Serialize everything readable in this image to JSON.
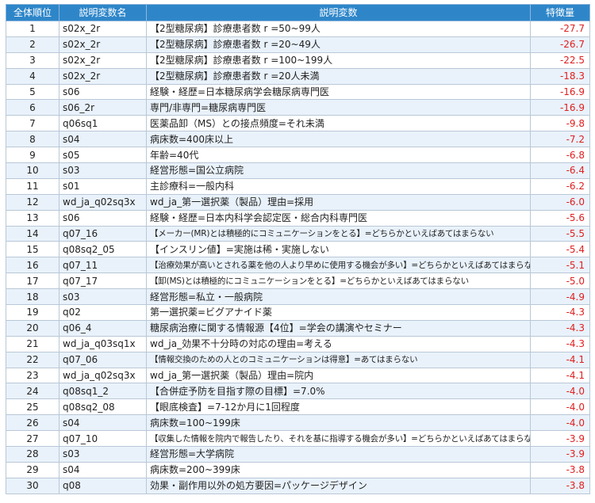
{
  "headers": [
    "全体順位",
    "説明変数名",
    "説明変数",
    "特徴量"
  ],
  "rows": [
    {
      "rank": "1",
      "code": "s02x_2r",
      "desc": "【2型糖尿病】診療患者数 r =50~99人",
      "value": "-27.7"
    },
    {
      "rank": "2",
      "code": "s02x_2r",
      "desc": "【2型糖尿病】診療患者数 r =20~49人",
      "value": "-26.7"
    },
    {
      "rank": "3",
      "code": "s02x_2r",
      "desc": "【2型糖尿病】診療患者数 r =100~199人",
      "value": "-22.5"
    },
    {
      "rank": "4",
      "code": "s02x_2r",
      "desc": "【2型糖尿病】診療患者数 r =20人未満",
      "value": "-18.3"
    },
    {
      "rank": "5",
      "code": "s06",
      "desc": "経験・経歴=日本糖尿病学会糖尿病専門医",
      "value": "-16.9"
    },
    {
      "rank": "6",
      "code": "s06_2r",
      "desc": "専門/非専門=糖尿病専門医",
      "value": "-16.9"
    },
    {
      "rank": "7",
      "code": "q06sq1",
      "desc": "医薬品卸（MS）との接点頻度=それ未満",
      "value": "-9.8"
    },
    {
      "rank": "8",
      "code": "s04",
      "desc": "病床数=400床以上",
      "value": "-7.2"
    },
    {
      "rank": "9",
      "code": "s05",
      "desc": "年齢=40代",
      "value": "-6.8"
    },
    {
      "rank": "10",
      "code": "s03",
      "desc": "経営形態=国公立病院",
      "value": "-6.4"
    },
    {
      "rank": "11",
      "code": "s01",
      "desc": "主診療科=一般内科",
      "value": "-6.2"
    },
    {
      "rank": "12",
      "code": "wd_ja_q02sq3x",
      "desc": "wd_ja_第一選択薬（製品）理由=採用",
      "value": "-6.0"
    },
    {
      "rank": "13",
      "code": "s06",
      "desc": "経験・経歴=日本内科学会認定医・総合内科専門医",
      "value": "-5.6"
    },
    {
      "rank": "14",
      "code": "q07_16",
      "desc": "【メーカー(MR)とは積極的にコミュニケーションをとる】=どちらかといえばあてはまらない",
      "value": "-5.5",
      "small": true
    },
    {
      "rank": "15",
      "code": "q08sq2_05",
      "desc": "【インスリン値】=実施は稀・実施しない",
      "value": "-5.4"
    },
    {
      "rank": "16",
      "code": "q07_11",
      "desc": "【治療効果が高いとされる薬を他の人より早めに使用する機会が多い】=どちらかといえばあてはまらない",
      "value": "-5.1",
      "small": true
    },
    {
      "rank": "17",
      "code": "q07_17",
      "desc": "【卸(MS)とは積極的にコミュニケーションをとる】=どちらかといえばあてはまらない",
      "value": "-5.0",
      "small": true
    },
    {
      "rank": "18",
      "code": "s03",
      "desc": "経営形態=私立・一般病院",
      "value": "-4.9"
    },
    {
      "rank": "19",
      "code": "q02",
      "desc": "第一選択薬=ビグアナイド薬",
      "value": "-4.3"
    },
    {
      "rank": "20",
      "code": "q06_4",
      "desc": "糖尿病治療に関する情報源【4位】=学会の講演やセミナー",
      "value": "-4.3"
    },
    {
      "rank": "21",
      "code": "wd_ja_q03sq1x",
      "desc": "wd_ja_効果不十分時の対応の理由=考える",
      "value": "-4.3"
    },
    {
      "rank": "22",
      "code": "q07_06",
      "desc": "【情報交換のための人とのコミュニケーションは得意】=あてはまらない",
      "value": "-4.1",
      "small": true
    },
    {
      "rank": "23",
      "code": "wd_ja_q02sq3x",
      "desc": "wd_ja_第一選択薬（製品）理由=院内",
      "value": "-4.1"
    },
    {
      "rank": "24",
      "code": "q08sq1_2",
      "desc": "【合併症予防を目指す際の目標】=7.0%",
      "value": "-4.0"
    },
    {
      "rank": "25",
      "code": "q08sq2_08",
      "desc": "【眼底検査】=7-12か月に1回程度",
      "value": "-4.0"
    },
    {
      "rank": "26",
      "code": "s04",
      "desc": "病床数=100~199床",
      "value": "-4.0"
    },
    {
      "rank": "27",
      "code": "q07_10",
      "desc": "【収集した情報を院内で報告したり、それを基に指導する機会が多い】=どちらかといえばあてはまらない",
      "value": "-3.9",
      "small": true
    },
    {
      "rank": "28",
      "code": "s03",
      "desc": "経営形態=大学病院",
      "value": "-3.9"
    },
    {
      "rank": "29",
      "code": "s04",
      "desc": "病床数=200~399床",
      "value": "-3.8"
    },
    {
      "rank": "30",
      "code": "q08",
      "desc": "効果・副作用以外の処方要因=パッケージデザイン",
      "value": "-3.8"
    }
  ]
}
